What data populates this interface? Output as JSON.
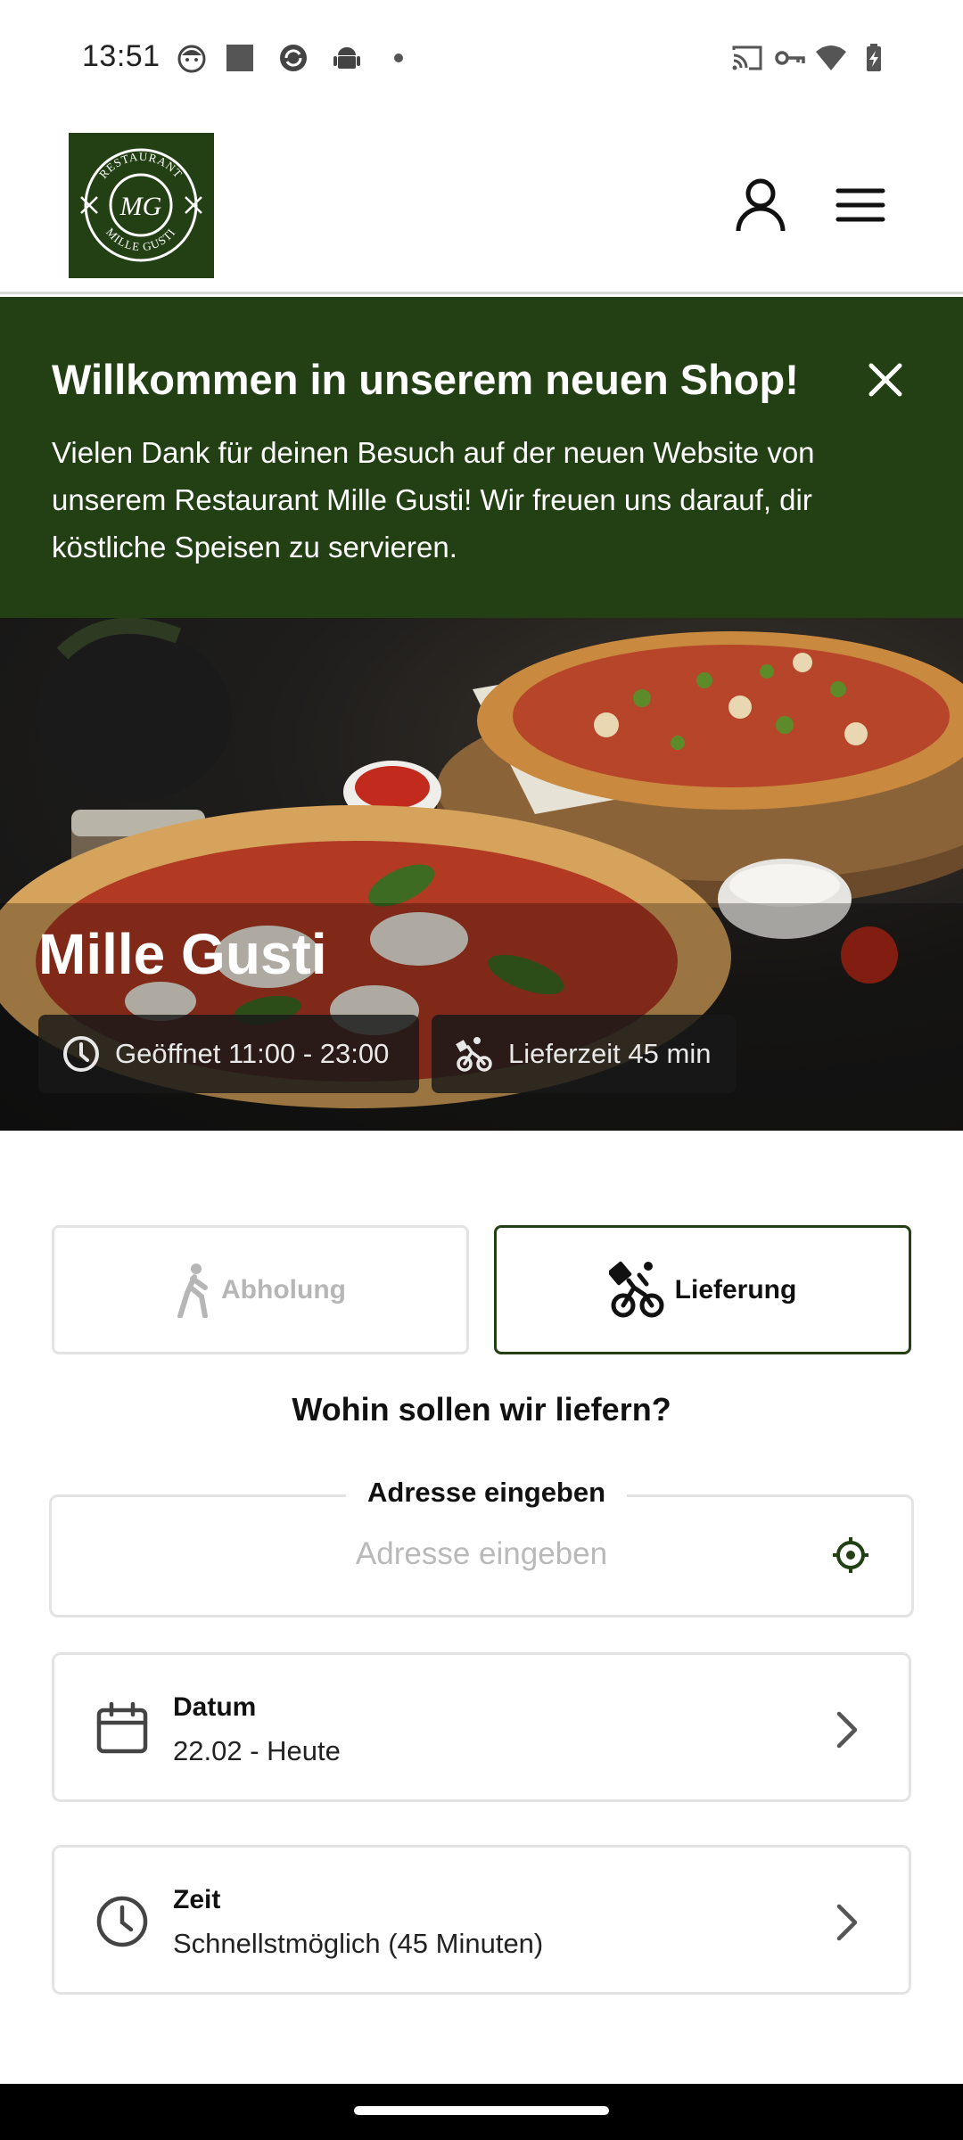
{
  "status_bar": {
    "time": "13:51",
    "left_icons": [
      "face-notification-icon",
      "gallery-notification-icon",
      "sync-notification-icon",
      "android-notification-icon",
      "dot-icon"
    ],
    "right_icons": [
      "cast-icon",
      "vpn-key-icon",
      "wifi-icon",
      "battery-charging-icon"
    ]
  },
  "header": {
    "logo_top": "RESTAURANT",
    "logo_monogram": "MG",
    "logo_bottom": "MILLE GUSTI",
    "account_icon": "user-icon",
    "menu_icon": "hamburger-menu-icon"
  },
  "banner": {
    "title": "Willkommen in unserem neuen Shop!",
    "text": "Vielen Dank für deinen Besuch auf der neuen Website von unserem Restaurant Mille Gusti! Wir freuen uns darauf, dir köstliche Speisen zu servieren.",
    "close_icon": "close-icon"
  },
  "hero": {
    "title": "Mille Gusti",
    "opening_hours": "Geöffnet 11:00 - 23:00",
    "delivery_time": "Lieferzeit 45 min"
  },
  "order_type": {
    "pickup_label": "Abholung",
    "delivery_label": "Lieferung",
    "selected": "Lieferung"
  },
  "delivery": {
    "question": "Wohin sollen wir liefern?",
    "address_legend": "Adresse eingeben",
    "address_placeholder": "Adresse eingeben",
    "address_value": ""
  },
  "date_card": {
    "label": "Datum",
    "value": "22.02 - Heute"
  },
  "time_card": {
    "label": "Zeit",
    "value": "Schnellstmöglich (45 Minuten)"
  },
  "colors": {
    "brand_green": "#233f14",
    "border_gray": "#e3e3e3",
    "muted_text": "#b6b6b6"
  }
}
